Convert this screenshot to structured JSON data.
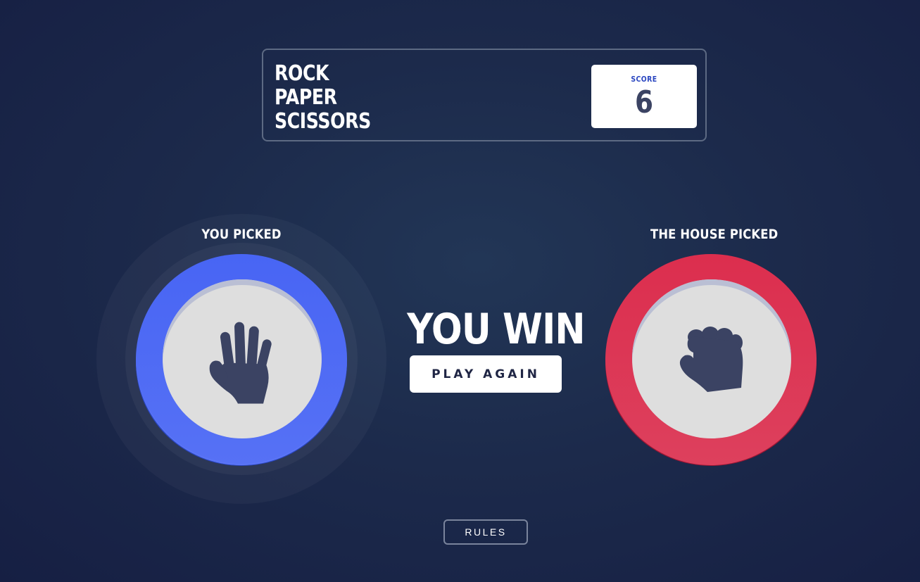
{
  "header": {
    "title_lines": [
      "ROCK",
      "PAPER",
      "SCISSORS"
    ],
    "score_label": "SCORE",
    "score_value": "6"
  },
  "game": {
    "player_label": "YOU PICKED",
    "house_label": "THE HOUSE PICKED",
    "player_choice": "paper",
    "house_choice": "rock",
    "player_icon": "paper-hand-icon",
    "house_icon": "rock-fist-icon",
    "result_text": "YOU WIN",
    "play_again_label": "PLAY AGAIN"
  },
  "footer": {
    "rules_label": "RULES"
  },
  "colors": {
    "background": "#1c2a4b",
    "paper": "#4865f4",
    "rock": "#dc2e4e",
    "icon": "#3b4363",
    "score_label": "#2a46c0"
  }
}
